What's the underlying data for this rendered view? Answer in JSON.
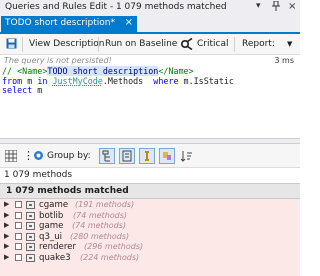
{
  "window": {
    "title": "Queries and Rules Edit - 1 079 methods matched",
    "pin_icon": "pin-icon",
    "close_icon": "close-icon",
    "dropdown_icon": "dropdown-icon"
  },
  "tab": {
    "label": "TODO short description*",
    "close": "×"
  },
  "toolbar": {
    "view_description": "View Description",
    "run_on_baseline": "Run on Baseline",
    "critical": "Critical",
    "report": "Report:"
  },
  "status": {
    "message": "The query is not persisted!",
    "duration": "3 ms"
  },
  "editor": {
    "line1": {
      "comment_prefix": "// ",
      "open_tag": "<Name>",
      "name_text": "TODO short description",
      "close_tag": "</Name>"
    },
    "line2": {
      "kw_from": "from",
      "var_m": " m ",
      "kw_in": "in",
      "space": " ",
      "type_name": "JustMyCode",
      "dot_methods": ".Methods  ",
      "kw_where": "where",
      "expr": " m.IsStatic"
    },
    "line3": {
      "kw_select": "select",
      "var": " m"
    }
  },
  "results": {
    "group_by_label": "Group by:",
    "count_text": "1 079 methods",
    "header": "1 079 methods matched",
    "items": [
      {
        "name": "cgame",
        "count": "(191 methods)"
      },
      {
        "name": "botlib",
        "count": "(74 methods)"
      },
      {
        "name": "game",
        "count": "(74 methods)"
      },
      {
        "name": "q3_ui",
        "count": "(280 methods)"
      },
      {
        "name": "renderer",
        "count": "(296 methods)"
      },
      {
        "name": "quake3",
        "count": "(224 methods)"
      }
    ]
  },
  "colors": {
    "accent": "#007acc",
    "list_background": "#fde8e8",
    "comment": "#008000",
    "keyword": "#0000ff"
  }
}
